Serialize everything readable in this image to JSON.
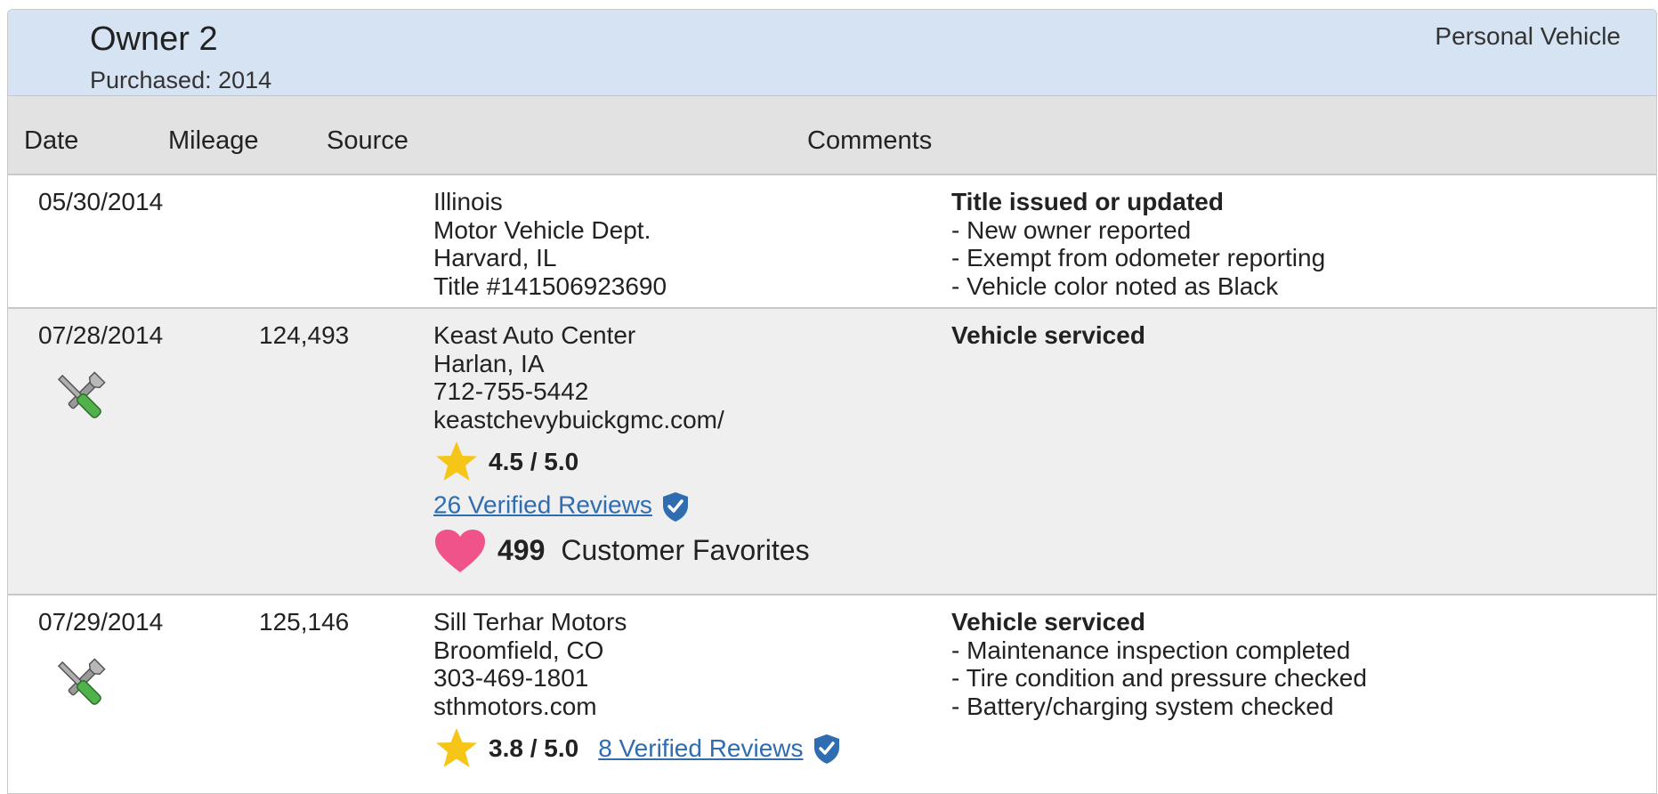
{
  "owner": {
    "title": "Owner 2",
    "purchased": "Purchased: 2014",
    "vehicle_type": "Personal Vehicle"
  },
  "columns": {
    "date": "Date",
    "mileage": "Mileage",
    "source": "Source",
    "comments": "Comments"
  },
  "records": [
    {
      "date": "05/30/2014",
      "mileage": "",
      "source": [
        "Illinois",
        "Motor Vehicle Dept.",
        "Harvard, IL",
        "Title #141506923690"
      ],
      "comment_title": "Title issued or updated",
      "comment_items": [
        "- New owner reported",
        "- Exempt from odometer reporting",
        "- Vehicle color noted as Black"
      ]
    },
    {
      "date": "07/28/2014",
      "mileage": "124,493",
      "source": [
        "Keast Auto Center",
        "Harlan, IA",
        "712-755-5442",
        "keastchevybuickgmc.com/"
      ],
      "rating": "4.5 / 5.0",
      "reviews_link": "26 Verified Reviews",
      "favorites_count": "499",
      "favorites_label": "Customer Favorites",
      "comment_title": "Vehicle serviced",
      "comment_items": []
    },
    {
      "date": "07/29/2014",
      "mileage": "125,146",
      "source": [
        "Sill Terhar Motors",
        "Broomfield, CO",
        "303-469-1801",
        "sthmotors.com"
      ],
      "rating": "3.8 / 5.0",
      "reviews_link": "8 Verified Reviews",
      "comment_title": "Vehicle serviced",
      "comment_items": [
        "- Maintenance inspection completed",
        "- Tire condition and pressure checked",
        "- Battery/charging system checked"
      ]
    }
  ],
  "colors": {
    "header_bg": "#d6e3f2",
    "column_header_bg": "#e2e2e2",
    "alt_row_bg": "#efefef",
    "link": "#2f6db0",
    "star": "#f5c518",
    "heart": "#f0528a",
    "shield": "#2f6db0"
  },
  "icons": [
    "service-wrench-icon",
    "star-icon",
    "verified-shield-icon",
    "heart-icon"
  ]
}
